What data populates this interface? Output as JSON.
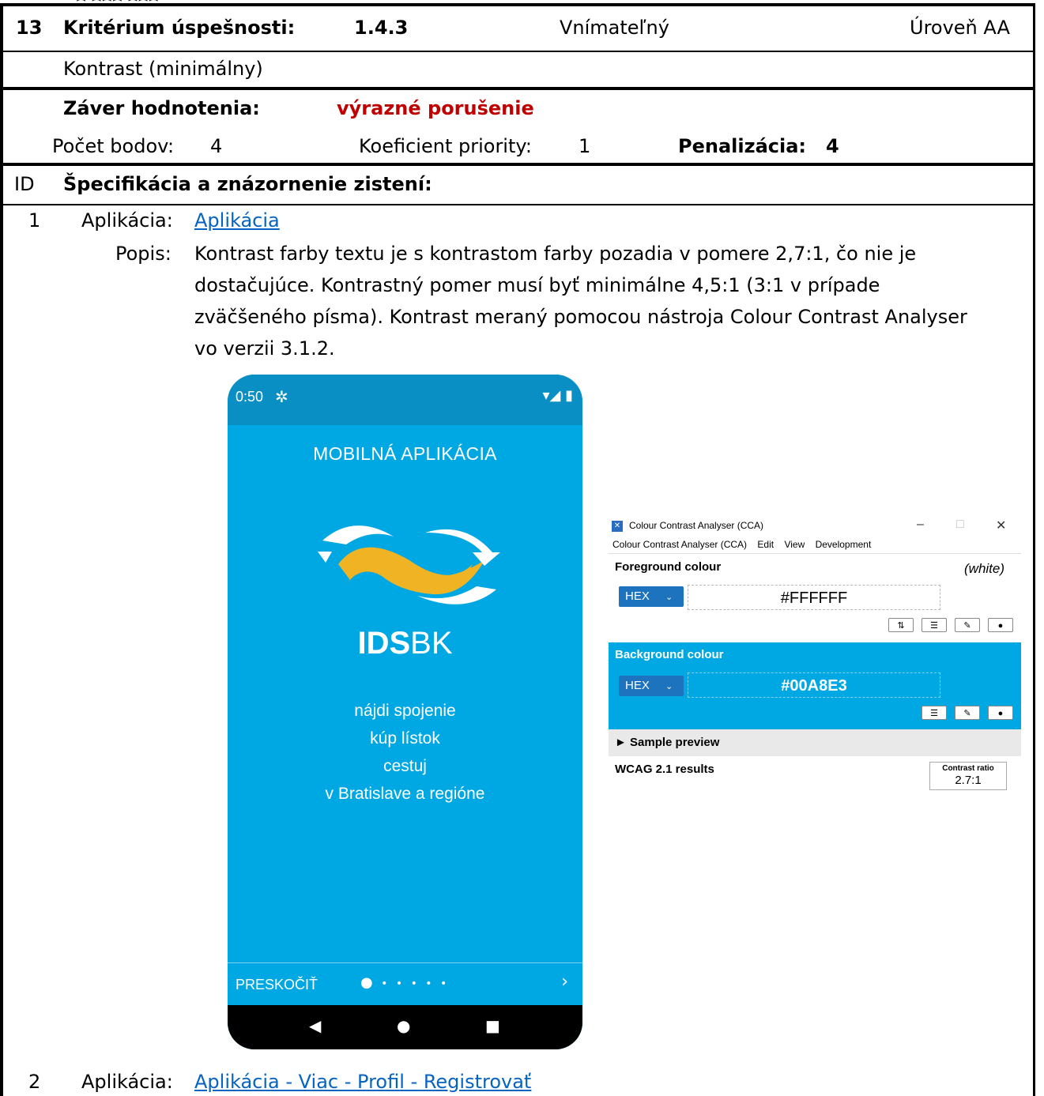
{
  "header": {
    "number": "13",
    "criterion_label": "Kritérium úspešnosti:",
    "criterion_id": "1.4.3",
    "principle": "Vnímateľný",
    "level": "Úroveň AA",
    "criterion_name": "Kontrast (minimálny)"
  },
  "evaluation": {
    "conclusion_label": "Záver hodnotenia:",
    "conclusion_value": "výrazné porušenie",
    "conclusion_color": "#c00000",
    "points_label": "Počet bodov:",
    "points_value": "4",
    "priority_label": "Koeficient priority:",
    "priority_value": "1",
    "penalty_label": "Penalizácia:",
    "penalty_value": "4"
  },
  "findings": {
    "id_label": "ID",
    "heading": "Špecifikácia a znázornenie zistení:",
    "items": [
      {
        "id": "1",
        "app_label": "Aplikácia:",
        "app_link": "Aplikácia",
        "desc_label": "Popis:",
        "desc_lines": [
          "Kontrast farby textu je s kontrastom farby pozadia v pomere 2,7:1, čo nie je",
          "dostačujúce. Kontrastný pomer musí byť minimálne 4,5:1 (3:1 v prípade",
          "zväčšeného písma). Kontrast meraný pomocou nástroja Colour Contrast Analyser",
          "vo verzii 3.1.2."
        ]
      },
      {
        "id": "2",
        "app_label": "Aplikácia:",
        "app_link": "Aplikácia - Viac - Profil - Registrovať"
      }
    ]
  },
  "phone": {
    "time": "0:50",
    "gear_icon": "gear-icon",
    "title": "MOBILNÁ APLIKÁCIA",
    "brand_bold": "IDS",
    "brand_light": "BK",
    "tagline": [
      "nájdi spojenie",
      "kúp lístok",
      "cestuj",
      "v Bratislave a regióne"
    ],
    "skip": "PRESKOČIŤ",
    "background_color": "#00a8e3",
    "logo_color": "#f0b323"
  },
  "cca": {
    "window_title": "Colour Contrast Analyser (CCA)",
    "menu": [
      "Colour Contrast Analyser (CCA)",
      "Edit",
      "View",
      "Development"
    ],
    "foreground_label": "Foreground colour",
    "foreground_name": "(white)",
    "format": "HEX",
    "foreground_value": "#FFFFFF",
    "background_label": "Background colour",
    "background_value": "#00A8E3",
    "sample_preview": "► Sample preview",
    "results_label": "WCAG 2.1 results",
    "ratio_label": "Contrast ratio",
    "ratio_value": "2.7:1"
  }
}
